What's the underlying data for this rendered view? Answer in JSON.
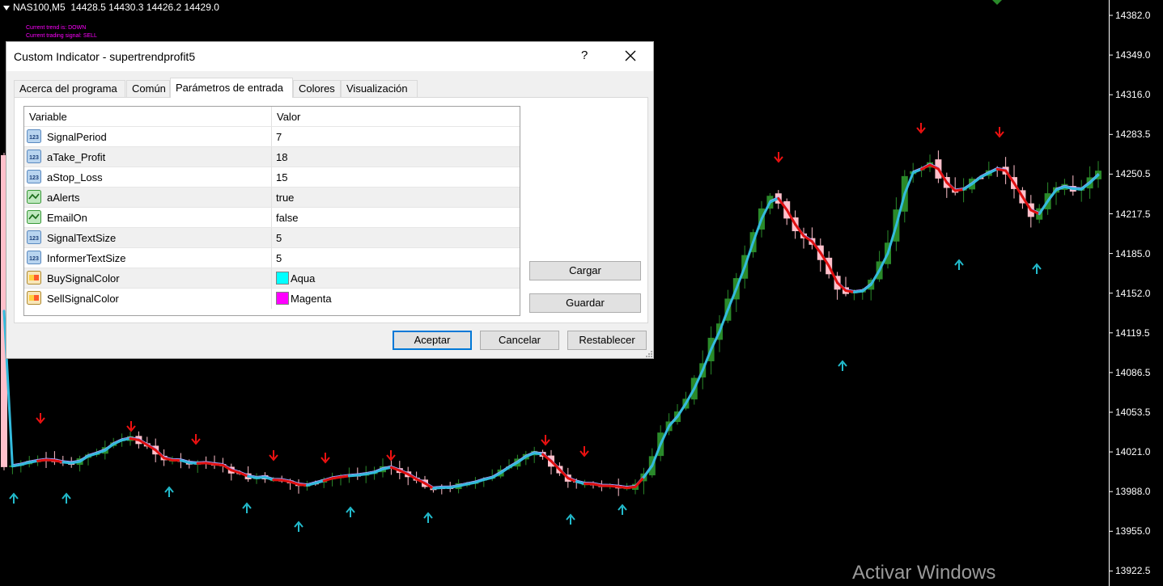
{
  "header": {
    "symbol": "NAS100,M5",
    "ohlc": "14428.5 14430.3 14426.2 14429.0",
    "trend_text": "Current trend is: DOWN",
    "signal_text": "Current trading signal: SELL"
  },
  "price_axis": [
    "14382.0",
    "14349.0",
    "14316.0",
    "14283.5",
    "14250.5",
    "14217.5",
    "14185.0",
    "14152.0",
    "14119.5",
    "14086.5",
    "14053.5",
    "14021.0",
    "13988.0",
    "13955.0",
    "13922.5"
  ],
  "watermark": "Activar Windows",
  "colors": {
    "bull": "#2a8a2a",
    "bear": "#ffc0cb",
    "line_up": "#33bbdd",
    "line_down": "#e01010",
    "buy_arrow": "#22bbcc",
    "sell_arrow": "#ee1111"
  },
  "dialog": {
    "title": "Custom Indicator - supertrendprofit5",
    "help": "?",
    "tabs": [
      "Acerca del programa",
      "Común",
      "Parámetros de entrada",
      "Colores",
      "Visualización"
    ],
    "active_tab": "Parámetros de entrada",
    "columns": {
      "variable": "Variable",
      "value": "Valor"
    },
    "params": [
      {
        "name": "SignalPeriod",
        "value": "7",
        "icon": "numeric-icon"
      },
      {
        "name": "aTake_Profit",
        "value": "18",
        "icon": "numeric-icon"
      },
      {
        "name": "aStop_Loss",
        "value": "15",
        "icon": "numeric-icon"
      },
      {
        "name": "aAlerts",
        "value": "true",
        "icon": "boolean-icon"
      },
      {
        "name": "EmailOn",
        "value": "false",
        "icon": "boolean-icon"
      },
      {
        "name": "SignalTextSize",
        "value": "5",
        "icon": "numeric-icon"
      },
      {
        "name": "InformerTextSize",
        "value": "5",
        "icon": "numeric-icon"
      },
      {
        "name": "BuySignalColor",
        "value": "Aqua",
        "icon": "color-icon",
        "swatch": "#00ffff"
      },
      {
        "name": "SellSignalColor",
        "value": "Magenta",
        "icon": "color-icon",
        "swatch": "#ff00ff"
      }
    ],
    "buttons": {
      "load": "Cargar",
      "save": "Guardar",
      "ok": "Aceptar",
      "cancel": "Cancelar",
      "reset": "Restablecer"
    }
  }
}
